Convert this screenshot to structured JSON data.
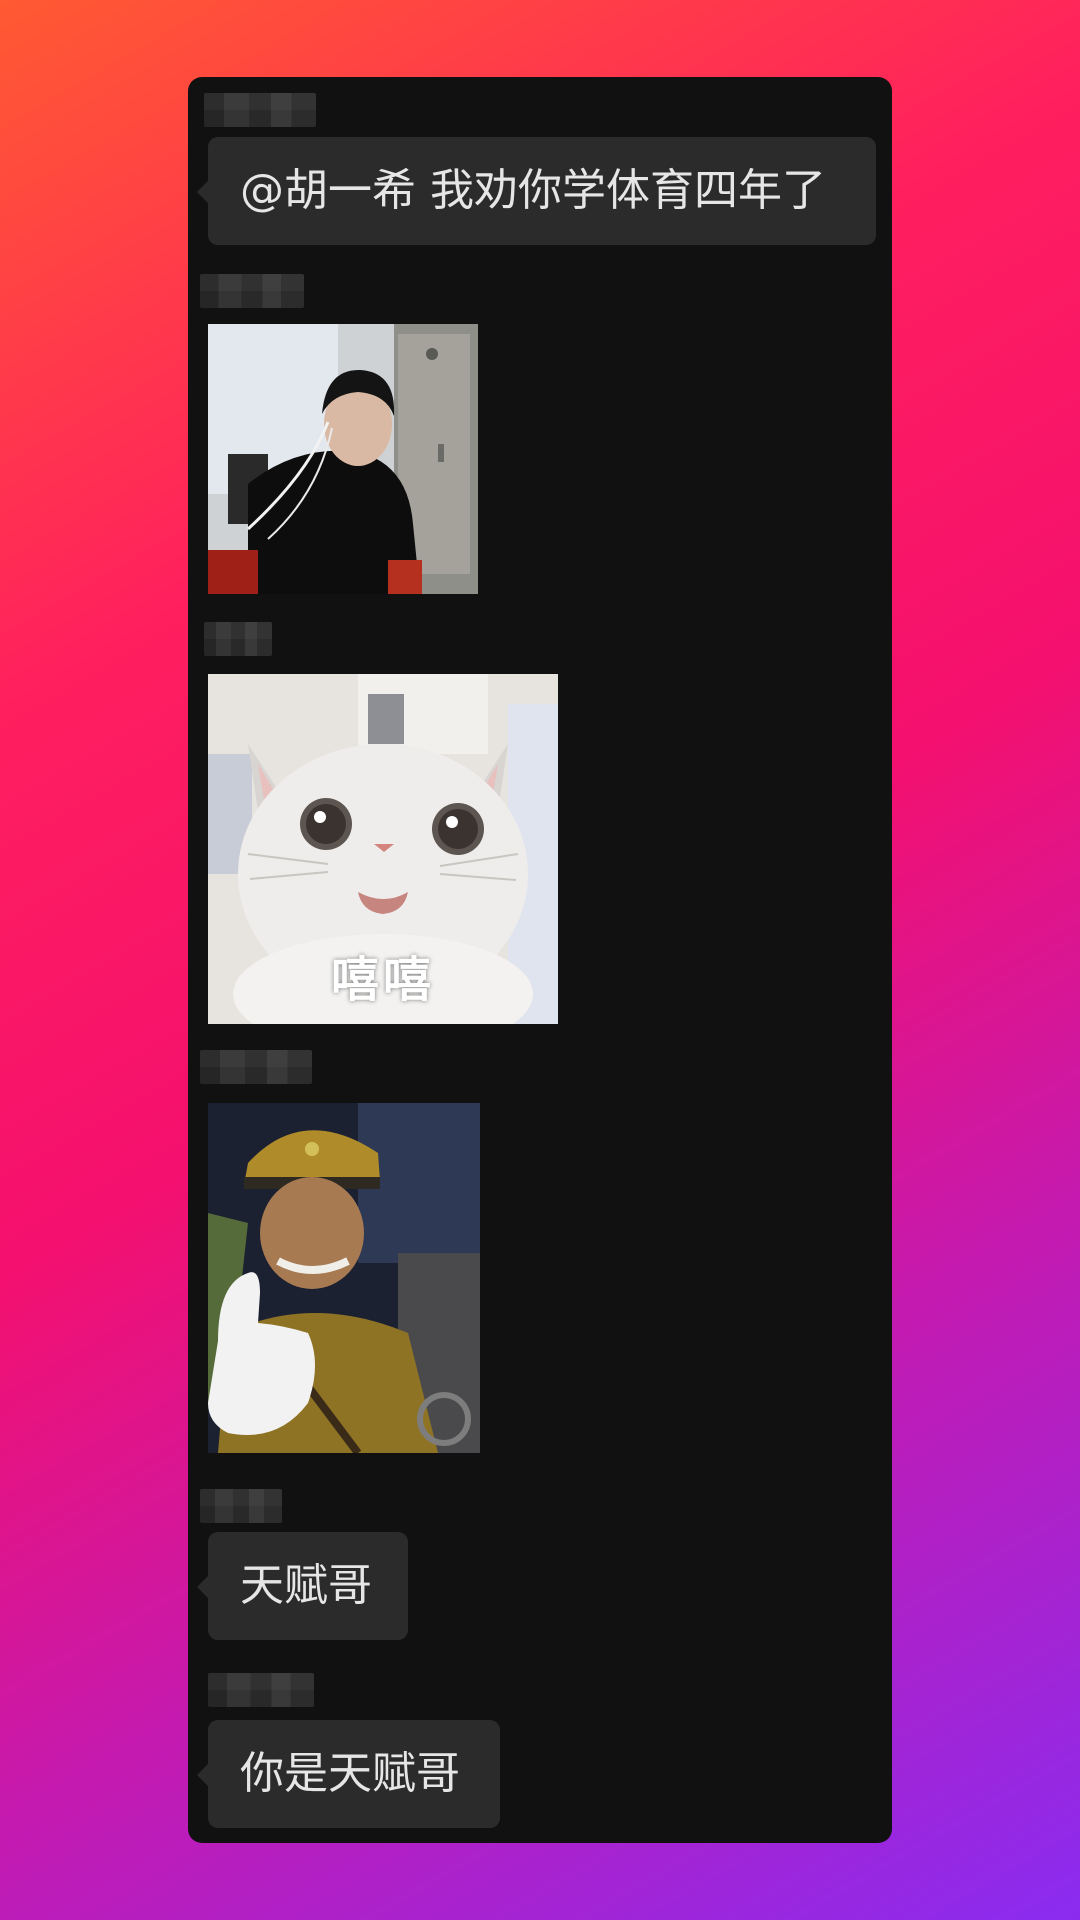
{
  "messages": [
    {
      "type": "text",
      "text": "@胡一希 我劝你学体育四年了"
    },
    {
      "type": "sticker",
      "icon": "person-headphones-sticker"
    },
    {
      "type": "sticker",
      "icon": "cat-sticker",
      "caption": "嘻嘻"
    },
    {
      "type": "sticker",
      "icon": "thumbs-up-soldier-sticker"
    },
    {
      "type": "text",
      "text": "天赋哥"
    },
    {
      "type": "text",
      "text": "你是天赋哥"
    }
  ],
  "colors": {
    "card_background": "#111111",
    "bubble_background": "#2b2b2b",
    "bubble_text": "#e6e6e6"
  }
}
